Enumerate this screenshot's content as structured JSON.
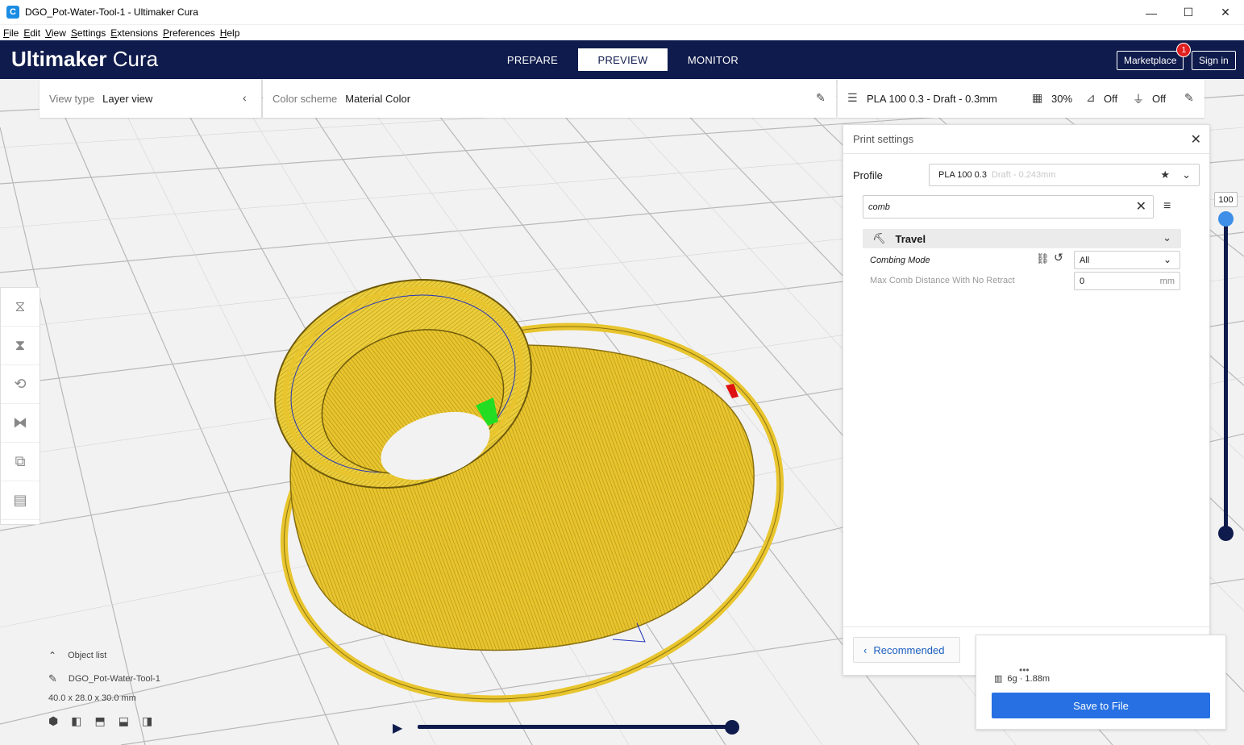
{
  "window": {
    "title": "DGO_Pot-Water-Tool-1 - Ultimaker Cura",
    "controls": [
      "—",
      "☐",
      "✕"
    ]
  },
  "menu": [
    "File",
    "Edit",
    "View",
    "Settings",
    "Extensions",
    "Preferences",
    "Help"
  ],
  "header": {
    "brand_bold": "Ultimaker",
    "brand_light": " Cura",
    "tabs": [
      "PREPARE",
      "PREVIEW",
      "MONITOR"
    ],
    "active_tab": "PREVIEW",
    "marketplace": "Marketplace",
    "marketplace_badge": "1",
    "signin": "Sign in"
  },
  "view_toolbar": {
    "view_type_label": "View type",
    "view_type_value": "Layer view",
    "color_scheme_label": "Color scheme",
    "color_scheme_value": "Material Color",
    "profile_summary": "PLA 100 0.3 - Draft - 0.3mm",
    "infill": "30%",
    "support": "Off",
    "adhesion": "Off"
  },
  "print_settings": {
    "title": "Print settings",
    "profile_label": "Profile",
    "profile_name": "PLA 100 0.3",
    "profile_sub": "Draft - 0.243mm",
    "search_value": "comb",
    "category": "Travel",
    "rows": [
      {
        "label": "Combing Mode",
        "value": "All"
      },
      {
        "label": "Max Comb Distance With No Retract",
        "value": "0",
        "unit": "mm"
      }
    ],
    "recommended_btn": "Recommended"
  },
  "output": {
    "estimate": "6g · 1.88m",
    "save_btn": "Save to File"
  },
  "object_list": {
    "title": "Object list",
    "object_name": "DGO_Pot-Water-Tool-1",
    "dimensions": "40.0 x 28.0 x 30.0 mm"
  },
  "layer_slider": {
    "current_layer": "100"
  },
  "colors": {
    "header_bg": "#0f1b4c",
    "accent_blue": "#2670e3",
    "model_yellow": "#f5d842"
  }
}
